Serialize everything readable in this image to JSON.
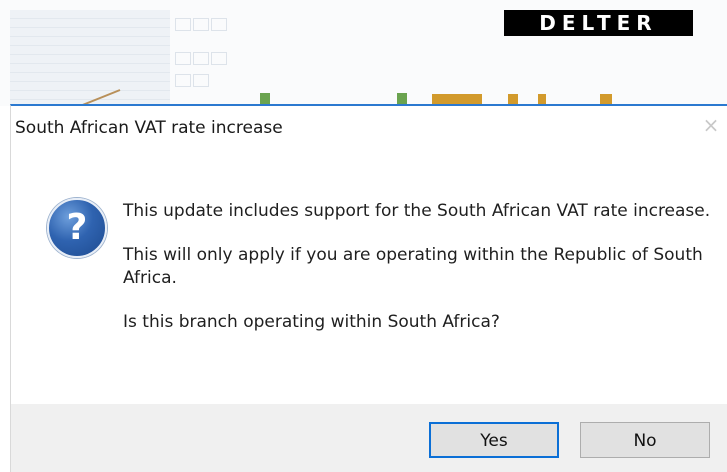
{
  "background": {
    "brand": "DELTER"
  },
  "dialog": {
    "title": "South African VAT rate increase",
    "close_glyph": "×",
    "icon": "question-icon",
    "icon_glyph": "?",
    "message": [
      "This update includes support for the South African VAT rate increase.",
      "This will only apply if you are operating within the Republic of South Africa.",
      "Is this branch operating within South Africa?"
    ],
    "buttons": {
      "yes_label": "Yes",
      "no_label": "No"
    }
  },
  "colors": {
    "accent": "#2b79d0",
    "default_button_border": "#0b6fd6",
    "button_bar": "#f0f0f0"
  }
}
